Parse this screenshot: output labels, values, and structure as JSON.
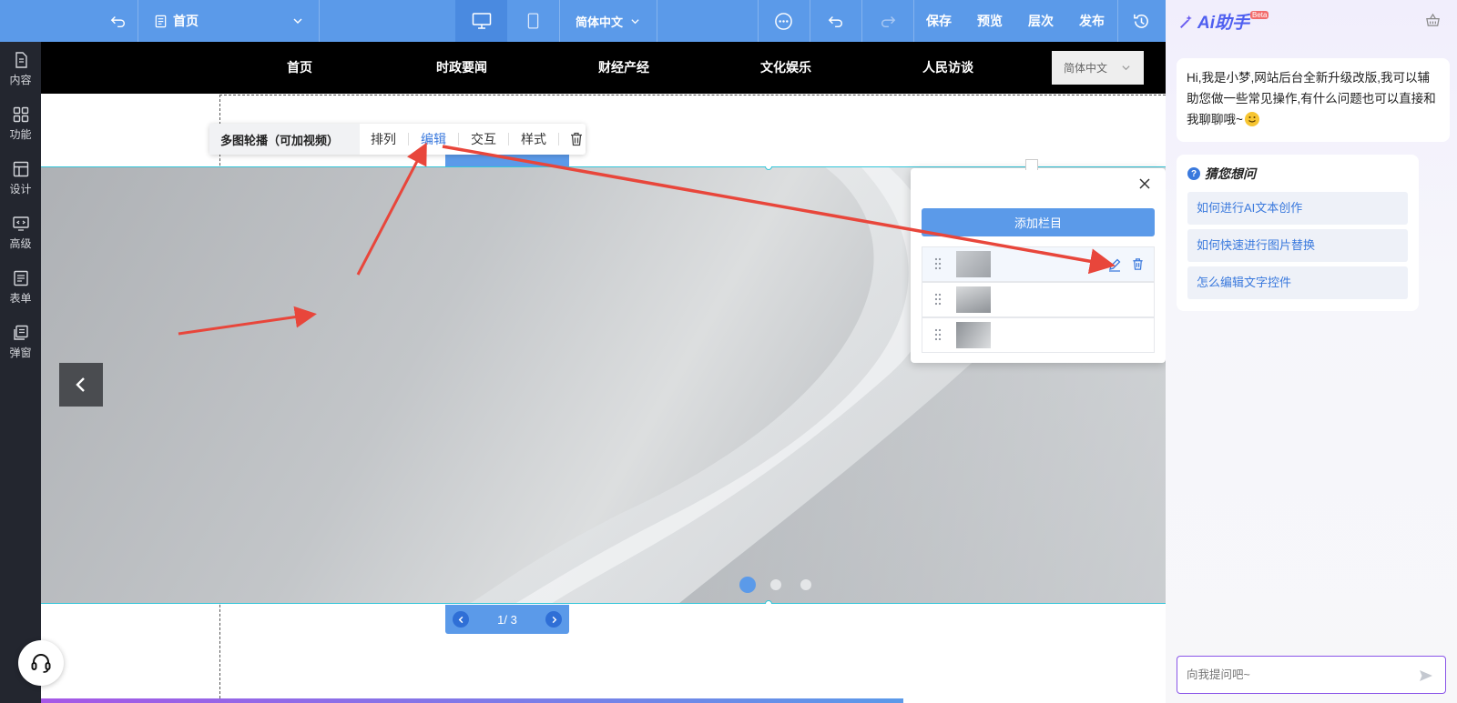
{
  "topbar": {
    "page_select": "首页",
    "language": "简体中文",
    "save": "保存",
    "preview": "预览",
    "layers": "层次",
    "publish": "发布"
  },
  "leftnav": {
    "items": [
      {
        "label": "内容",
        "icon": "document-icon"
      },
      {
        "label": "功能",
        "icon": "grid-icon"
      },
      {
        "label": "设计",
        "icon": "layout-icon"
      },
      {
        "label": "高级",
        "icon": "code-monitor-icon"
      },
      {
        "label": "表单",
        "icon": "form-icon"
      },
      {
        "label": "弹窗",
        "icon": "popup-icon"
      }
    ]
  },
  "site": {
    "nav": [
      "首页",
      "时政要闻",
      "财经产经",
      "文化娱乐",
      "人民访谈"
    ],
    "language": "简体中文"
  },
  "toolbar": {
    "title": "多图轮播（可加视频）",
    "arrange": "排列",
    "edit": "编辑",
    "interact": "交互",
    "style": "样式"
  },
  "carousel": {
    "pager_text": "1/ 3",
    "current_slide": 1,
    "total_slides": 3
  },
  "panel": {
    "add_button": "添加栏目"
  },
  "ai": {
    "title": "Ai助手",
    "badge": "Beta",
    "greeting": "Hi,我是小梦,网站后台全新升级改版,我可以辅助您做一些常见操作,有什么问题也可以直接和我聊聊哦~",
    "suggest_title": "猜您想问",
    "questions": [
      "如何进行AI文本创作",
      "如何快速进行图片替换",
      "怎么编辑文字控件"
    ],
    "input_placeholder": "向我提问吧~"
  },
  "colors": {
    "primary": "#5b9ae9",
    "nav_bg": "#23262f",
    "site_header": "#000000",
    "annotation_arrow": "#e8463b"
  }
}
